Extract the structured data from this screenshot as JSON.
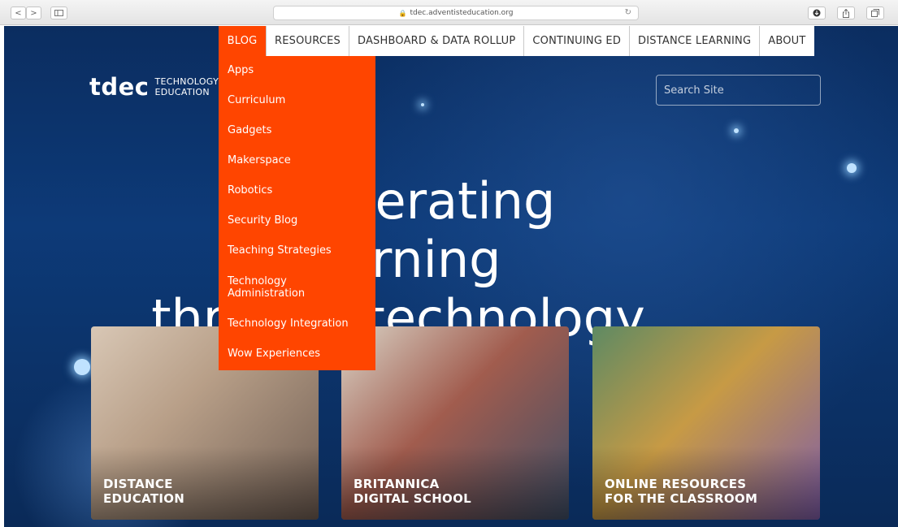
{
  "browser": {
    "url": "tdec.adventisteducation.org",
    "back_glyph": "<",
    "forward_glyph": ">"
  },
  "nav": {
    "items": [
      "BLOG",
      "RESOURCES",
      "DASHBOARD & DATA ROLLUP",
      "CONTINUING ED",
      "DISTANCE LEARNING",
      "ABOUT"
    ],
    "active": "BLOG"
  },
  "logo": {
    "mark": "tdec",
    "line1": "TECHNOLOGY",
    "line2": "EDUCATION"
  },
  "search": {
    "placeholder": "Search Site"
  },
  "hero": {
    "line1": "Accelerating learning",
    "line2": "through technology"
  },
  "dropdown": {
    "items": [
      "Apps",
      "Curriculum",
      "Gadgets",
      "Makerspace",
      "Robotics",
      "Security Blog",
      "Teaching Strategies",
      "Technology Administration",
      "Technology Integration",
      "Wow Experiences"
    ]
  },
  "cards": [
    {
      "line1": "DISTANCE",
      "line2": "EDUCATION"
    },
    {
      "line1": "BRITANNICA",
      "line2": "DIGITAL SCHOOL"
    },
    {
      "line1": "ONLINE RESOURCES",
      "line2": "FOR THE CLASSROOM"
    }
  ],
  "colors": {
    "accent": "#ff4500",
    "background": "#0d3a78"
  }
}
